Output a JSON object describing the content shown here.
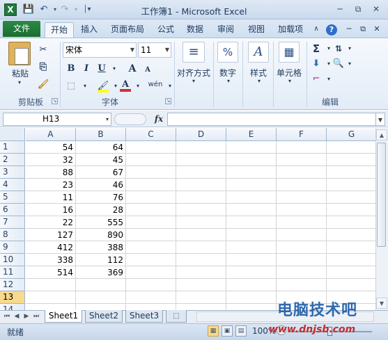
{
  "titlebar": {
    "app_icon": "X",
    "title": "工作簿1 - Microsoft Excel",
    "qat_icons": [
      "save-icon",
      "undo-icon",
      "redo-icon",
      "customize-qat-icon"
    ],
    "window_controls": [
      "minimize-icon",
      "restore-icon",
      "close-icon"
    ]
  },
  "ribbon_tabs": {
    "file": "文件",
    "tabs": [
      "开始",
      "插入",
      "页面布局",
      "公式",
      "数据",
      "审阅",
      "视图",
      "加载项"
    ],
    "active": "开始"
  },
  "ribbon": {
    "clipboard": {
      "paste": "粘贴",
      "label": "剪贴板"
    },
    "font": {
      "name": "宋体",
      "size": "11",
      "label": "字体",
      "bold": "B",
      "italic": "I",
      "underline": "U",
      "grow": "A",
      "shrink": "A",
      "wen": "wén",
      "font_color_accent": "#d32f2f",
      "fill_color_accent": "#ffff00"
    },
    "alignment": {
      "label": "对齐方式"
    },
    "number": {
      "label": "数字",
      "icon_text": "%"
    },
    "styles": {
      "label": "样式",
      "icon_text": "A"
    },
    "cells": {
      "label": "单元格"
    },
    "editing": {
      "label": "编辑",
      "sum": "Σ"
    }
  },
  "formula_bar": {
    "name_box": "H13",
    "fx": "fx",
    "value": ""
  },
  "grid": {
    "columns": [
      "A",
      "B",
      "C",
      "D",
      "E",
      "F",
      "G"
    ],
    "rows": [
      "1",
      "2",
      "3",
      "4",
      "5",
      "6",
      "7",
      "8",
      "9",
      "10",
      "11",
      "12",
      "13",
      "14"
    ],
    "selected_row": "13",
    "data": [
      [
        "54",
        "64"
      ],
      [
        "32",
        "45"
      ],
      [
        "88",
        "67"
      ],
      [
        "23",
        "46"
      ],
      [
        "11",
        "76"
      ],
      [
        "16",
        "28"
      ],
      [
        "22",
        "555"
      ],
      [
        "127",
        "890"
      ],
      [
        "412",
        "388"
      ],
      [
        "338",
        "112"
      ],
      [
        "514",
        "369"
      ]
    ]
  },
  "sheets": {
    "tabs": [
      "Sheet1",
      "Sheet2",
      "Sheet3"
    ],
    "active": "Sheet1"
  },
  "status": {
    "text": "就绪",
    "zoom": "100%"
  },
  "watermark": {
    "line1": "电脑技术吧",
    "line2": "www.dnjsb.com"
  }
}
